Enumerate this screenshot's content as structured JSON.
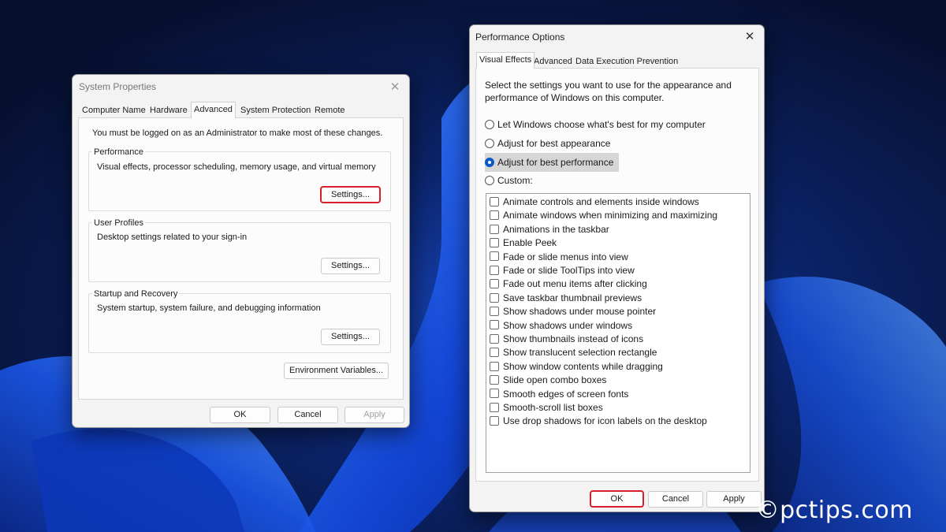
{
  "system_properties": {
    "title": "System Properties",
    "tabs": [
      "Computer Name",
      "Hardware",
      "Advanced",
      "System Protection",
      "Remote"
    ],
    "active_tab": "Advanced",
    "admin_note": "You must be logged on as an Administrator to make most of these changes.",
    "groups": {
      "performance": {
        "title": "Performance",
        "description": "Visual effects, processor scheduling, memory usage, and virtual memory",
        "button": "Settings..."
      },
      "user_profiles": {
        "title": "User Profiles",
        "description": "Desktop settings related to your sign-in",
        "button": "Settings..."
      },
      "startup_recovery": {
        "title": "Startup and Recovery",
        "description": "System startup, system failure, and debugging information",
        "button": "Settings..."
      }
    },
    "env_button": "Environment Variables...",
    "ok": "OK",
    "cancel": "Cancel",
    "apply": "Apply"
  },
  "performance_options": {
    "title": "Performance Options",
    "tabs": [
      "Visual Effects",
      "Advanced",
      "Data Execution Prevention"
    ],
    "active_tab": "Visual Effects",
    "intro": [
      "Select the settings you want to use for the appearance and",
      "performance of Windows on this computer."
    ],
    "radios": [
      {
        "label": "Let Windows choose what's best for my computer",
        "checked": false
      },
      {
        "label": "Adjust for best appearance",
        "checked": false
      },
      {
        "label": "Adjust for best performance",
        "checked": true
      },
      {
        "label": "Custom:",
        "checked": false
      }
    ],
    "effects": [
      "Animate controls and elements inside windows",
      "Animate windows when minimizing and maximizing",
      "Animations in the taskbar",
      "Enable Peek",
      "Fade or slide menus into view",
      "Fade or slide ToolTips into view",
      "Fade out menu items after clicking",
      "Save taskbar thumbnail previews",
      "Show shadows under mouse pointer",
      "Show shadows under windows",
      "Show thumbnails instead of icons",
      "Show translucent selection rectangle",
      "Show window contents while dragging",
      "Slide open combo boxes",
      "Smooth edges of screen fonts",
      "Smooth-scroll list boxes",
      "Use drop shadows for icon labels on the desktop"
    ],
    "ok": "OK",
    "cancel": "Cancel",
    "apply": "Apply"
  },
  "watermark": "©pctips.com",
  "colors": {
    "highlight_red": "#d81f2a",
    "radio_blue": "#0a5bc4",
    "wallpaper_dark": "#07163a"
  }
}
